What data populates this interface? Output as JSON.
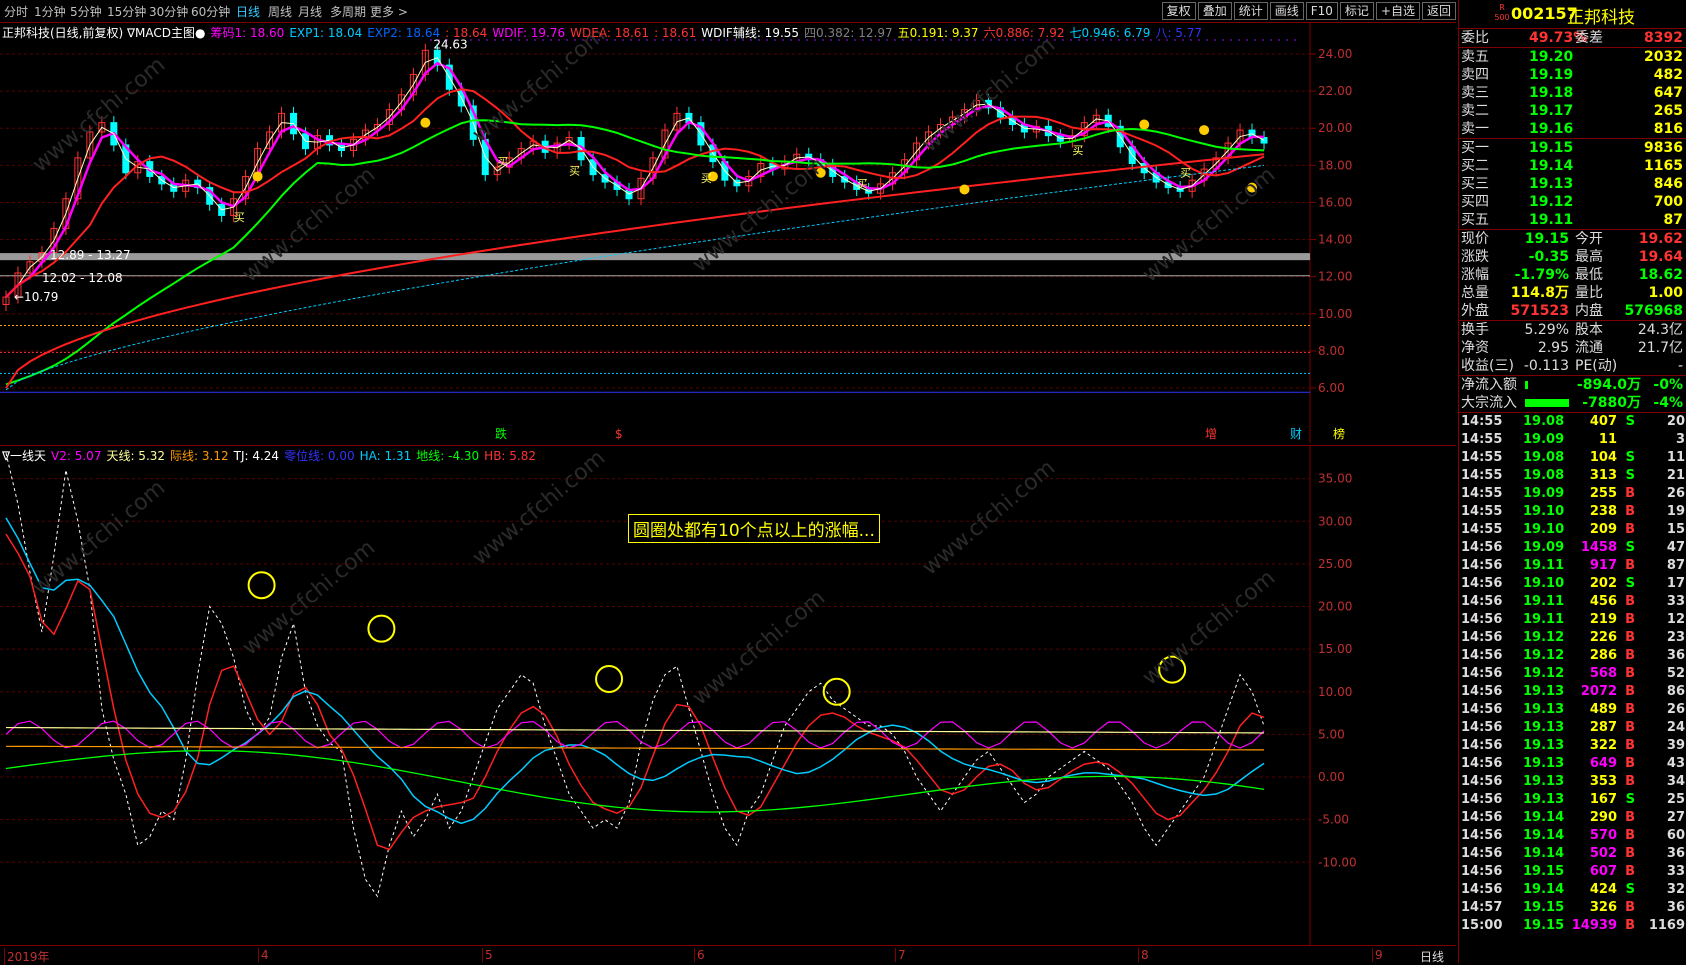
{
  "tabs": [
    "分时",
    "1分钟",
    "5分钟",
    "15分钟",
    "30分钟",
    "60分钟",
    "日线",
    "周线",
    "月线",
    "多周期",
    "更多"
  ],
  "tabs_active": "日线",
  "toolbar_buttons": [
    "复权",
    "叠加",
    "统计",
    "画线",
    "F10",
    "标记",
    "+自选",
    "返回"
  ],
  "upper_legend": {
    "title": "正邦科技(日线,前复权)",
    "indicator": "MACD主图",
    "items": [
      {
        "text": "筹码1: 18.60",
        "color": "#ff00ff"
      },
      {
        "text": "EXP1: 18.04",
        "color": "#00ccff"
      },
      {
        "text": "EXP2: 18.64",
        "color": "#0066ff"
      },
      {
        "text": ": 18.64",
        "color": "#ff3333"
      },
      {
        "text": "WDIF: 19.76",
        "color": "#ff00ff"
      },
      {
        "text": "WDEA: 18.61",
        "color": "#ff3333"
      },
      {
        "text": ": 18.61",
        "color": "#ff3333"
      },
      {
        "text": "WDIF辅线: 19.55",
        "color": "#ffffff"
      },
      {
        "text": "四0.382: 12.97",
        "color": "#808080"
      },
      {
        "text": "五0.191: 9.37",
        "color": "#ffff00"
      },
      {
        "text": "六0.886: 7.92",
        "color": "#ff3333"
      },
      {
        "text": "七0.946: 6.79",
        "color": "#00ccff"
      },
      {
        "text": "八: 5.77",
        "color": "#3333ff"
      }
    ]
  },
  "upper_axis": [
    "24.00",
    "22.00",
    "20.00",
    "18.00",
    "16.00",
    "14.00",
    "12.00",
    "10.00",
    "8.00",
    "6.00"
  ],
  "upper_annotations": {
    "high": "24.63",
    "low": "10.79",
    "range1": "12.89 - 13.27",
    "range2": "12.02 - 12.08",
    "buy_label": "买",
    "bottom_marks": [
      {
        "text": "跌",
        "color": "#00ff00"
      },
      {
        "text": "$",
        "color": "#ff3333"
      },
      {
        "text": "增",
        "color": "#ff3333"
      },
      {
        "text": "财",
        "color": "#00ccff"
      },
      {
        "text": "榜",
        "color": "#ffff00"
      }
    ]
  },
  "lower_legend": {
    "title": "一线天",
    "items": [
      {
        "text": "V2: 5.07",
        "color": "#ff00ff"
      },
      {
        "text": "天线: 5.32",
        "color": "#ffff99"
      },
      {
        "text": "际线: 3.12",
        "color": "#ff9900"
      },
      {
        "text": "TJ: 4.24",
        "color": "#ffffff"
      },
      {
        "text": "零位线: 0.00",
        "color": "#3333ff"
      },
      {
        "text": "HA: 1.31",
        "color": "#00ccff"
      },
      {
        "text": "地线: -4.30",
        "color": "#00ff00"
      },
      {
        "text": "HB: 5.82",
        "color": "#ff3333"
      }
    ]
  },
  "lower_axis": [
    "35.00",
    "30.00",
    "25.00",
    "20.00",
    "15.00",
    "10.00",
    "5.00",
    "0.00",
    "-5.00",
    "-10.00"
  ],
  "annotation_box": "圆圈处都有10个点以上的涨幅...",
  "time_axis": [
    "2019年",
    "4",
    "5",
    "6",
    "7",
    "8",
    "9"
  ],
  "time_mode": "日线",
  "watermark": "www.cfchi.com",
  "stock": {
    "code": "002157",
    "name": "正邦科技",
    "badge_top": "R",
    "badge_bot": "500"
  },
  "colors": {
    "up": "#ff3333",
    "down": "#00ffff",
    "border": "#800000",
    "green": "#00ff00",
    "yellow": "#ffff00"
  },
  "order_book": {
    "weibi_label": "委比",
    "weibi": "49.73%",
    "weicha_label": "委差",
    "weicha": "8392",
    "sells": [
      {
        "label": "卖五",
        "price": "19.20",
        "vol": "2032"
      },
      {
        "label": "卖四",
        "price": "19.19",
        "vol": "482"
      },
      {
        "label": "卖三",
        "price": "19.18",
        "vol": "647"
      },
      {
        "label": "卖二",
        "price": "19.17",
        "vol": "265"
      },
      {
        "label": "卖一",
        "price": "19.16",
        "vol": "816"
      }
    ],
    "buys": [
      {
        "label": "买一",
        "price": "19.15",
        "vol": "9836"
      },
      {
        "label": "买二",
        "price": "19.14",
        "vol": "1165"
      },
      {
        "label": "买三",
        "price": "19.13",
        "vol": "846"
      },
      {
        "label": "买四",
        "price": "19.12",
        "vol": "700"
      },
      {
        "label": "买五",
        "price": "19.11",
        "vol": "87"
      }
    ]
  },
  "quote": [
    {
      "l1": "现价",
      "v1": "19.15",
      "c1": "#00ff00",
      "l2": "今开",
      "v2": "19.62",
      "c2": "#ff3333"
    },
    {
      "l1": "涨跌",
      "v1": "-0.35",
      "c1": "#00ff00",
      "l2": "最高",
      "v2": "19.64",
      "c2": "#ff3333"
    },
    {
      "l1": "涨幅",
      "v1": "-1.79%",
      "c1": "#00ff00",
      "l2": "最低",
      "v2": "18.62",
      "c2": "#00ff00"
    },
    {
      "l1": "总量",
      "v1": "114.8万",
      "c1": "#ffff00",
      "l2": "量比",
      "v2": "1.00",
      "c2": "#ffff00"
    },
    {
      "l1": "外盘",
      "v1": "571523",
      "c1": "#ff3333",
      "l2": "内盘",
      "v2": "576968",
      "c2": "#00ff00"
    }
  ],
  "fin": [
    {
      "l1": "换手",
      "v1": "5.29%",
      "l2": "股本",
      "v2": "24.3亿"
    },
    {
      "l1": "净资",
      "v1": "2.95",
      "l2": "流通",
      "v2": "21.7亿"
    },
    {
      "l1": "收益(三)",
      "v1": "-0.113",
      "l2": "PE(动)",
      "v2": "-"
    }
  ],
  "flows": [
    {
      "label": "净流入额",
      "value": "-894.0万",
      "pct": "-0%",
      "bar": 0.04
    },
    {
      "label": "大宗流入",
      "value": "-7880万",
      "pct": "-4%",
      "bar": 0.55
    }
  ],
  "ticks": [
    {
      "t": "14:55",
      "p": "19.08",
      "v": "407",
      "s": "S",
      "n": "20"
    },
    {
      "t": "14:55",
      "p": "19.09",
      "v": "11",
      "s": "",
      "n": "3"
    },
    {
      "t": "14:55",
      "p": "19.08",
      "v": "104",
      "s": "S",
      "n": "11"
    },
    {
      "t": "14:55",
      "p": "19.08",
      "v": "313",
      "s": "S",
      "n": "21"
    },
    {
      "t": "14:55",
      "p": "19.09",
      "v": "255",
      "s": "B",
      "n": "26"
    },
    {
      "t": "14:55",
      "p": "19.10",
      "v": "238",
      "s": "B",
      "n": "19"
    },
    {
      "t": "14:55",
      "p": "19.10",
      "v": "209",
      "s": "B",
      "n": "15"
    },
    {
      "t": "14:56",
      "p": "19.09",
      "v": "1458",
      "s": "S",
      "n": "47"
    },
    {
      "t": "14:56",
      "p": "19.11",
      "v": "917",
      "s": "B",
      "n": "87"
    },
    {
      "t": "14:56",
      "p": "19.10",
      "v": "202",
      "s": "S",
      "n": "17"
    },
    {
      "t": "14:56",
      "p": "19.11",
      "v": "456",
      "s": "B",
      "n": "33"
    },
    {
      "t": "14:56",
      "p": "19.11",
      "v": "219",
      "s": "B",
      "n": "12"
    },
    {
      "t": "14:56",
      "p": "19.12",
      "v": "226",
      "s": "B",
      "n": "23"
    },
    {
      "t": "14:56",
      "p": "19.12",
      "v": "286",
      "s": "B",
      "n": "36"
    },
    {
      "t": "14:56",
      "p": "19.12",
      "v": "568",
      "s": "B",
      "n": "52"
    },
    {
      "t": "14:56",
      "p": "19.13",
      "v": "2072",
      "s": "B",
      "n": "86"
    },
    {
      "t": "14:56",
      "p": "19.13",
      "v": "489",
      "s": "B",
      "n": "26"
    },
    {
      "t": "14:56",
      "p": "19.13",
      "v": "287",
      "s": "B",
      "n": "24"
    },
    {
      "t": "14:56",
      "p": "19.13",
      "v": "322",
      "s": "B",
      "n": "39"
    },
    {
      "t": "14:56",
      "p": "19.13",
      "v": "649",
      "s": "B",
      "n": "43"
    },
    {
      "t": "14:56",
      "p": "19.13",
      "v": "353",
      "s": "B",
      "n": "34"
    },
    {
      "t": "14:56",
      "p": "19.13",
      "v": "167",
      "s": "S",
      "n": "25"
    },
    {
      "t": "14:56",
      "p": "19.14",
      "v": "290",
      "s": "B",
      "n": "27"
    },
    {
      "t": "14:56",
      "p": "19.14",
      "v": "570",
      "s": "B",
      "n": "60"
    },
    {
      "t": "14:56",
      "p": "19.14",
      "v": "502",
      "s": "B",
      "n": "36"
    },
    {
      "t": "14:56",
      "p": "19.15",
      "v": "607",
      "s": "B",
      "n": "33"
    },
    {
      "t": "14:56",
      "p": "19.14",
      "v": "424",
      "s": "S",
      "n": "32"
    },
    {
      "t": "14:57",
      "p": "19.15",
      "v": "326",
      "s": "B",
      "n": "36"
    },
    {
      "t": "15:00",
      "p": "19.15",
      "v": "14939",
      "s": "B",
      "n": "1169"
    }
  ]
}
